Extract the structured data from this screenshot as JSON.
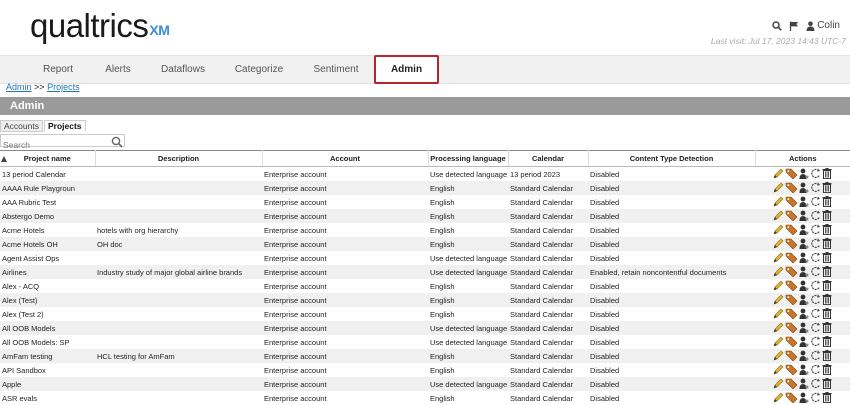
{
  "header": {
    "logo_text": "qualtrics",
    "logo_xm": "XM",
    "user_name": "Colin",
    "last_visit": "Last visit: Jul 17, 2023 14:43 UTC-7"
  },
  "nav": {
    "tabs": [
      {
        "label": "Report"
      },
      {
        "label": "Alerts"
      },
      {
        "label": "Dataflows"
      },
      {
        "label": "Categorize"
      },
      {
        "label": "Sentiment"
      },
      {
        "label": "Admin"
      }
    ],
    "active": "Admin"
  },
  "breadcrumb": {
    "root": "Admin",
    "separator": ">>",
    "current": "Projects"
  },
  "section_title": "Admin",
  "subtabs": [
    {
      "label": "Accounts"
    },
    {
      "label": "Projects"
    }
  ],
  "search": {
    "placeholder": "Search",
    "value": ""
  },
  "table": {
    "columns": [
      "Project name",
      "Description",
      "Account",
      "Processing language",
      "Calendar",
      "Content Type Detection",
      "Actions"
    ],
    "rows": [
      [
        "13 period Calendar",
        "",
        "Enterprise account",
        "Use detected language",
        "13 period 2023",
        "Disabled"
      ],
      [
        "AAAA Rule Playgroun",
        "",
        "Enterprise account",
        "English",
        "Standard Calendar",
        "Disabled"
      ],
      [
        "AAA Rubric Test",
        "",
        "Enterprise account",
        "English",
        "Standard Calendar",
        "Disabled"
      ],
      [
        "Abstergo Demo",
        "",
        "Enterprise account",
        "English",
        "Standard Calendar",
        "Disabled"
      ],
      [
        "Acme Hotels",
        "hotels with org hierarchy",
        "Enterprise account",
        "English",
        "Standard Calendar",
        "Disabled"
      ],
      [
        "Acme Hotels OH",
        "OH doc",
        "Enterprise account",
        "English",
        "Standard Calendar",
        "Disabled"
      ],
      [
        "Agent Assist Ops",
        "",
        "Enterprise account",
        "Use detected language",
        "Standard Calendar",
        "Disabled"
      ],
      [
        "Airlines",
        "Industry study of major global airline brands",
        "Enterprise account",
        "Use detected language",
        "Standard Calendar",
        "Enabled, retain noncontentful documents"
      ],
      [
        "Alex - ACQ",
        "",
        "Enterprise account",
        "English",
        "Standard Calendar",
        "Disabled"
      ],
      [
        "Alex (Test)",
        "",
        "Enterprise account",
        "English",
        "Standard Calendar",
        "Disabled"
      ],
      [
        "Alex (Test 2)",
        "",
        "Enterprise account",
        "English",
        "Standard Calendar",
        "Disabled"
      ],
      [
        "All OOB Models",
        "",
        "Enterprise account",
        "Use detected language",
        "Standard Calendar",
        "Disabled"
      ],
      [
        "All OOB Models: SP",
        "",
        "Enterprise account",
        "Use detected language",
        "Standard Calendar",
        "Disabled"
      ],
      [
        "AmFam testing",
        "HCL testing for AmFam",
        "Enterprise account",
        "English",
        "Standard Calendar",
        "Disabled"
      ],
      [
        "API Sandbox",
        "",
        "Enterprise account",
        "English",
        "Standard Calendar",
        "Disabled"
      ],
      [
        "Apple",
        "",
        "Enterprise account",
        "Use detected language",
        "Standard Calendar",
        "Disabled"
      ],
      [
        "ASR evals",
        "",
        "Enterprise account",
        "English",
        "Standard Calendar",
        "Disabled"
      ]
    ],
    "action_icons": [
      "pencil-icon",
      "tags-icon",
      "user-icon",
      "refresh-icon",
      "trash-icon"
    ]
  },
  "colors": {
    "accent": "#b3262d",
    "link": "#2477b5",
    "admin_bar": "#9a9a9a",
    "xm": "#3a8fd6"
  }
}
